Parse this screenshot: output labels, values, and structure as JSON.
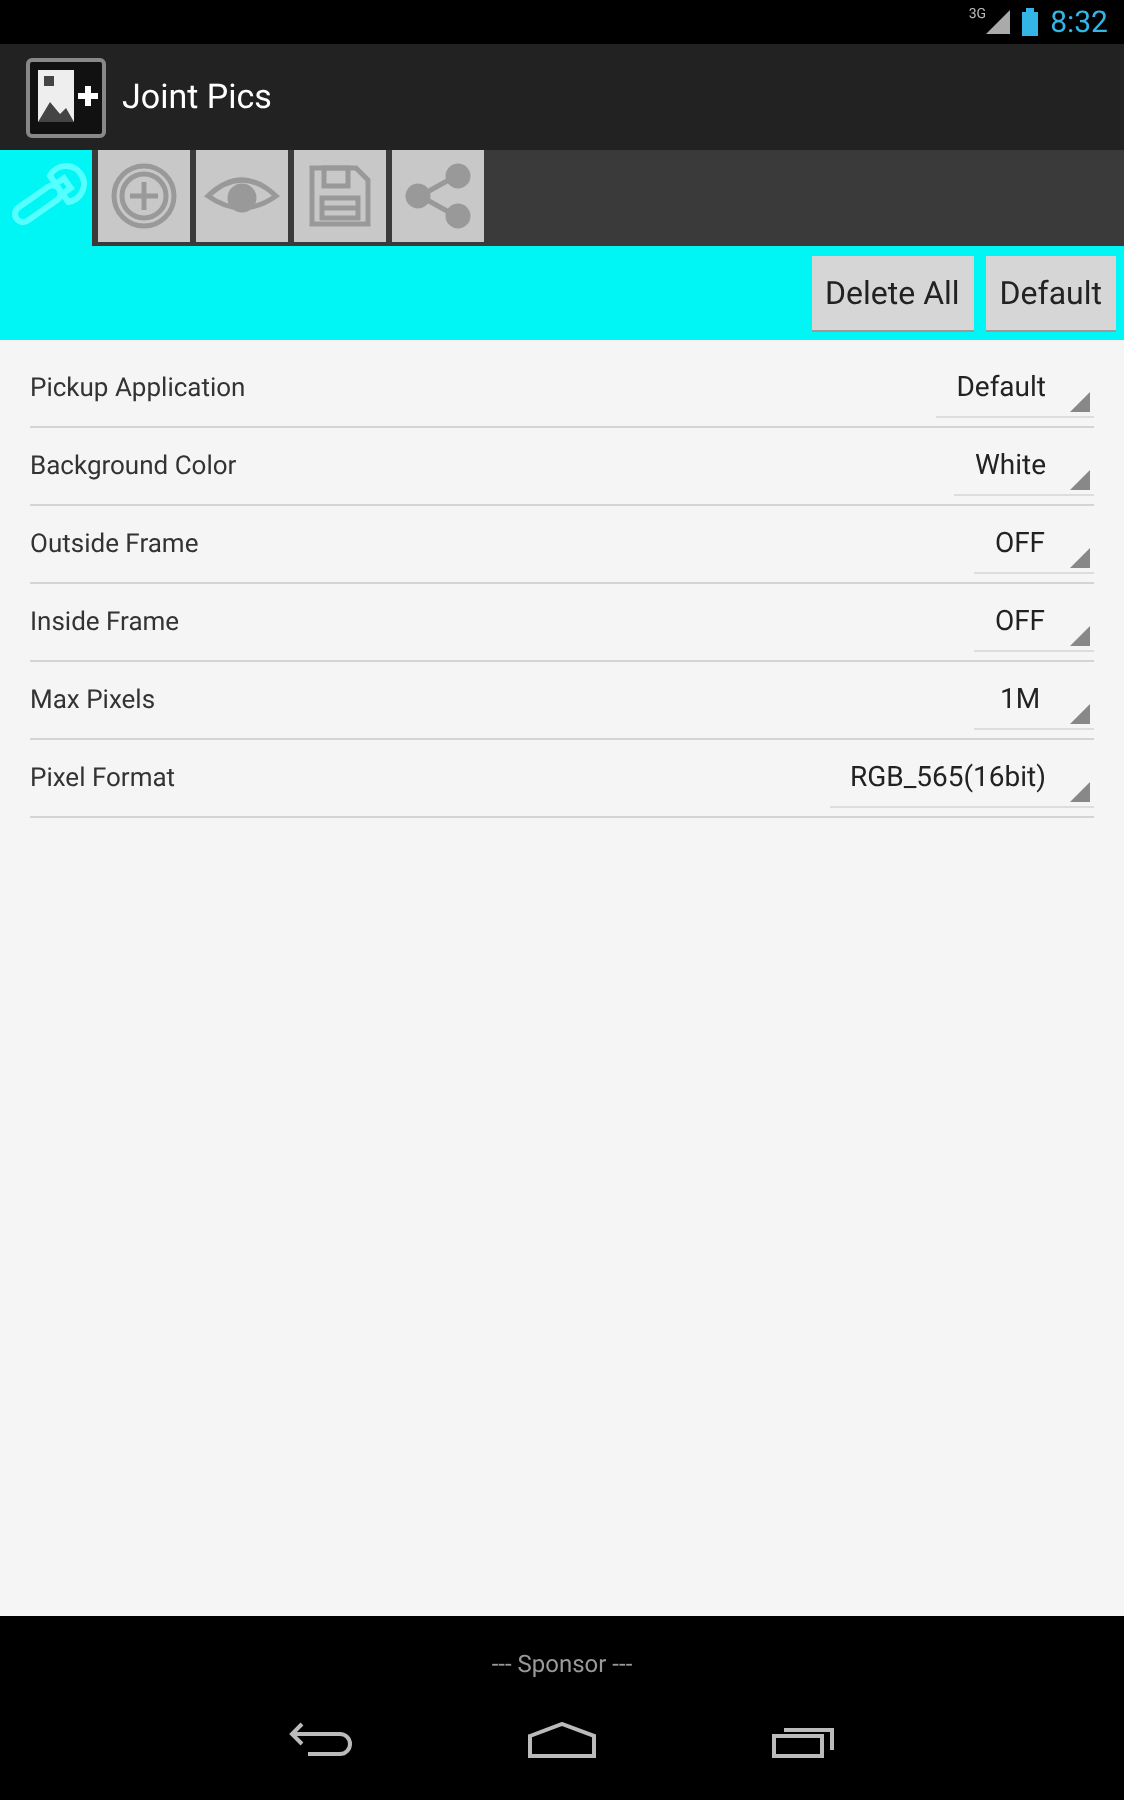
{
  "status_bar": {
    "network": "3G",
    "time": "8:32"
  },
  "action_bar": {
    "title": "Joint Pics"
  },
  "tabs": [
    {
      "kind": "wrench",
      "selected": true
    },
    {
      "kind": "add",
      "selected": false
    },
    {
      "kind": "eye",
      "selected": false
    },
    {
      "kind": "save",
      "selected": false
    },
    {
      "kind": "share",
      "selected": false
    }
  ],
  "toolbar": {
    "buttons": [
      "Delete All",
      "Default"
    ]
  },
  "settings": [
    {
      "label": "Pickup Application",
      "value": "Default"
    },
    {
      "label": "Background Color",
      "value": "White"
    },
    {
      "label": "Outside Frame",
      "value": "OFF"
    },
    {
      "label": "Inside Frame",
      "value": "OFF"
    },
    {
      "label": "Max Pixels",
      "value": "1M"
    },
    {
      "label": "Pixel Format",
      "value": "RGB_565(16bit)"
    }
  ],
  "footer": {
    "sponsor": "--- Sponsor ---"
  }
}
